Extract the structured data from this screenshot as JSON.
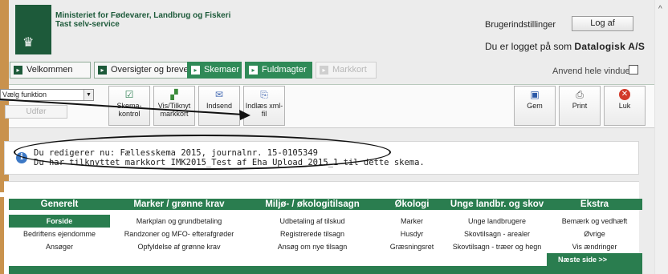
{
  "header": {
    "ministry_line1": "Ministeriet for Fødevarer, Landbrug og Fiskeri",
    "ministry_line2": "Tast selv-service",
    "user_settings": "Brugerindstillinger",
    "logout": "Log af",
    "logged_in_prefix": "Du er logget på som",
    "logged_in_user": "Datalogisk A/S",
    "apply_window": "Anvend hele vinduet"
  },
  "tabs": [
    {
      "label": "Velkommen"
    },
    {
      "label": "Oversigter og breve"
    },
    {
      "label": "Skemaer"
    },
    {
      "label": "Fuldmagter"
    },
    {
      "label": "Markkort"
    }
  ],
  "toolbar": {
    "select_value": "Vælg funktion",
    "udfor": "Udfør",
    "skemakontrol_1": "Skema-",
    "skemakontrol_2": "kontrol",
    "vis_1": "Vis/Tilknyt",
    "vis_2": "markkort",
    "indsend": "Indsend",
    "indlaes_1": "Indlæs xml-",
    "indlaes_2": "fil",
    "gem": "Gem",
    "print": "Print",
    "luk": "Luk"
  },
  "info": {
    "line1": "Du redigerer nu: Fællesskema 2015, journalnr. 15-0105349",
    "line2": "Du har tilknyttet markkort IMK2015_Test af Eha Upload 2015_1 til dette skema."
  },
  "nav": {
    "headers": [
      "Generelt",
      "Marker / grønne krav",
      "Miljø- / økologitilsagn",
      "Økologi",
      "Unge landbr. og skov",
      "Ekstra"
    ],
    "rows": [
      [
        "Forside",
        "Markplan og grundbetaling",
        "Udbetaling af tilskud",
        "Marker",
        "Unge landbrugere",
        "Bemærk og vedhæft"
      ],
      [
        "Bedriftens ejendomme",
        "Randzoner og MFO- efterafgrøder",
        "Registrerede tilsagn",
        "Husdyr",
        "Skovtilsagn - arealer",
        "Øvrige"
      ],
      [
        "Ansøger",
        "Opfyldelse af grønne krav",
        "Ansøg om nye tilsagn",
        "Græsningsret",
        "Skovtilsagn - træer og hegn",
        "Vis ændringer"
      ]
    ],
    "next": "Næste side >>"
  }
}
